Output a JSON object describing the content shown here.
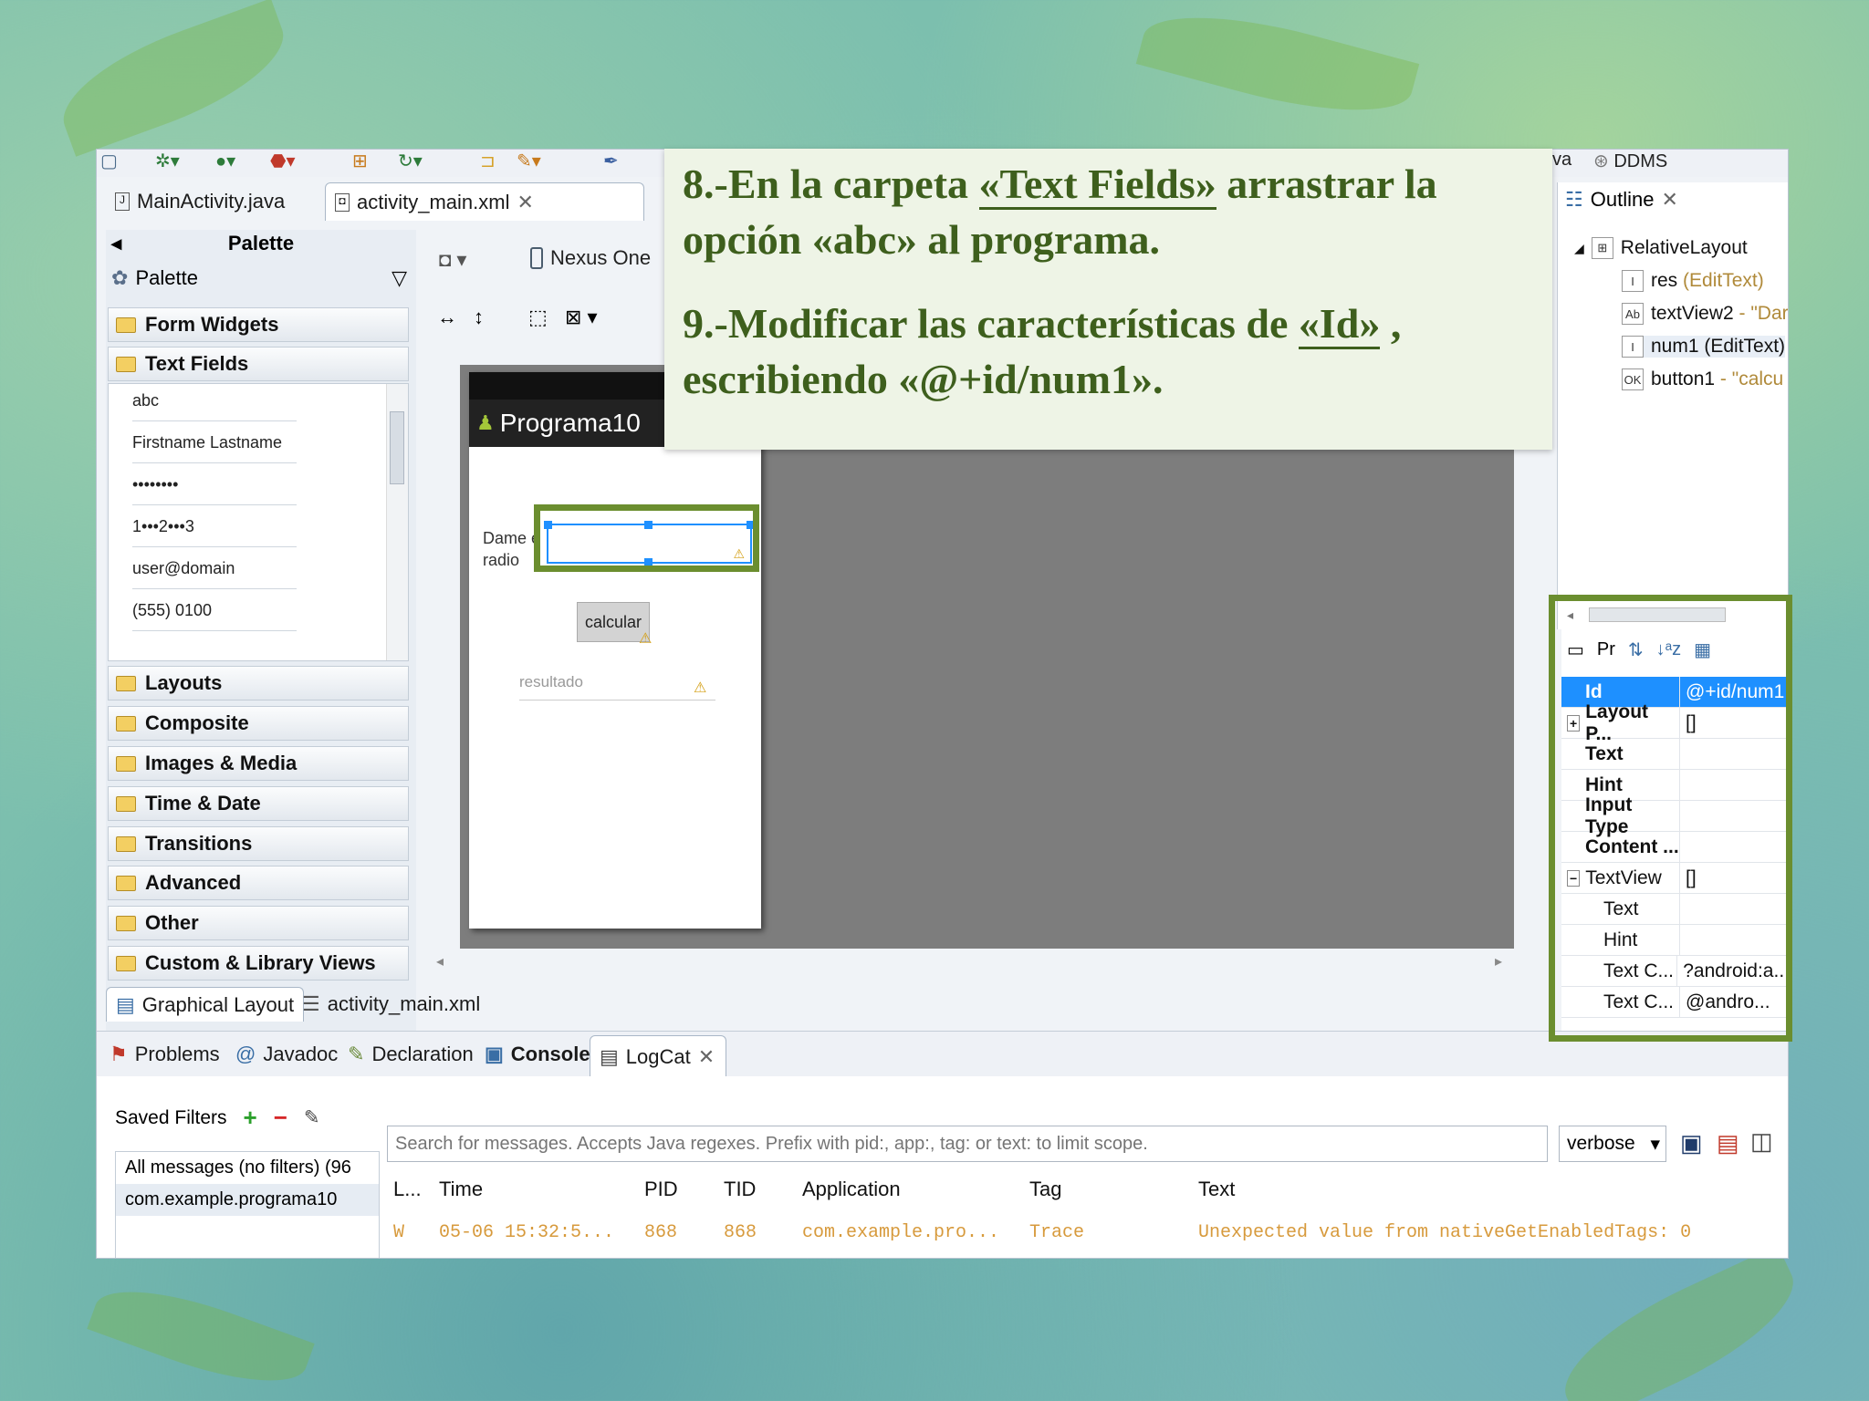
{
  "toolbar_tail": {
    "java_label": "va",
    "ddms_label": "DDMS"
  },
  "editor_tabs": [
    {
      "label": "MainActivity.java"
    },
    {
      "label": "activity_main.xml"
    }
  ],
  "palette": {
    "header": "Palette",
    "selector": "Palette",
    "categories": [
      "Form Widgets",
      "Text Fields",
      "Layouts",
      "Composite",
      "Images & Media",
      "Time & Date",
      "Transitions",
      "Advanced",
      "Other",
      "Custom & Library Views"
    ],
    "text_fields_items": [
      "abc",
      "Firstname Lastname",
      "••••••••",
      "1•••2•••3",
      "user@domain",
      "(555) 0100"
    ]
  },
  "canvas": {
    "device": "Nexus One",
    "app_title": "Programa10",
    "label_text_1": "Dame e",
    "label_text_2": "radio",
    "button_label": "calcular",
    "result_hint": "resultado"
  },
  "editor_bottom_tabs": [
    "Graphical Layout",
    "activity_main.xml"
  ],
  "outline": {
    "title": "Outline",
    "root": "RelativeLayout",
    "children": [
      {
        "name": "res",
        "type": " (EditText)"
      },
      {
        "name": "textView2",
        "type": " - \"Dar"
      },
      {
        "name": "num1 (EditText)",
        "type": ""
      },
      {
        "name": "button1",
        "type": " - \"calcu"
      }
    ]
  },
  "properties": {
    "toolbar_label": "Pr",
    "rows": [
      {
        "name": "Id",
        "value": "@+id/num1"
      },
      {
        "name": "Layout P...",
        "value": "[]"
      },
      {
        "name": "Text",
        "value": ""
      },
      {
        "name": "Hint",
        "value": ""
      },
      {
        "name": "Input Type",
        "value": ""
      },
      {
        "name": "Content ...",
        "value": ""
      },
      {
        "name": "TextView",
        "value": "[]"
      },
      {
        "name": "Text",
        "value": ""
      },
      {
        "name": "Hint",
        "value": ""
      },
      {
        "name": "Text C...",
        "value": "?android:a..."
      },
      {
        "name": "Text C...",
        "value": "@andro..."
      }
    ]
  },
  "bottom_tabs": [
    "Problems",
    "Javadoc",
    "Declaration",
    "Console",
    "LogCat"
  ],
  "logcat": {
    "saved_filters": "Saved Filters",
    "filters": [
      "All messages (no filters) (96",
      "com.example.programa10"
    ],
    "search_placeholder": "Search for messages. Accepts Java regexes. Prefix with pid:, app:, tag: or text: to limit scope.",
    "level_select": "verbose",
    "columns": [
      "L...",
      "Time",
      "PID",
      "TID",
      "Application",
      "Tag",
      "Text"
    ],
    "rows": [
      {
        "level": "W",
        "time": "05-06 15:32:5...",
        "pid": "868",
        "tid": "868",
        "app": "com.example.pro...",
        "tag": "Trace",
        "text": "Unexpected value from nativeGetEnabledTags: 0"
      }
    ]
  },
  "instructions": {
    "step8_a": "8.-En la carpeta ",
    "step8_b": "«Text Fields»",
    "step8_c": " arrastrar la opción «abc» al programa.",
    "step9_a": "9.-Modificar las características  de ",
    "step9_b": "«Id»",
    "step9_c": " , escribiendo «@+id/num1»."
  },
  "colors": {
    "highlight_frame": "#6b8e2f",
    "note_text": "#3e5f1d",
    "selection": "#1e90ff",
    "log_warning": "#d79a3c"
  }
}
